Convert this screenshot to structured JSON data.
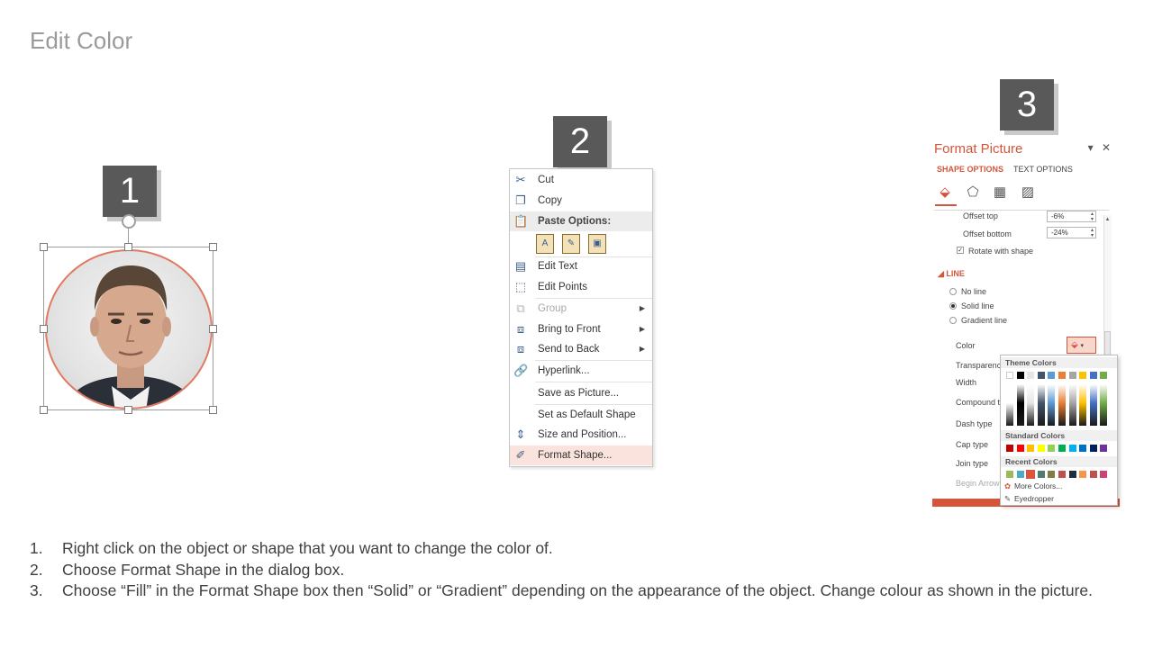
{
  "slide": {
    "title": "Edit Color"
  },
  "badges": [
    "1",
    "2",
    "3"
  ],
  "context_menu": {
    "items": [
      {
        "label": "Cut",
        "icon": "scissors-icon"
      },
      {
        "label": "Copy",
        "icon": "copy-icon"
      },
      {
        "label": "Paste Options:",
        "icon": "paste-icon"
      },
      {
        "label": "Edit Text",
        "icon": "edit-text-icon"
      },
      {
        "label": "Edit Points",
        "icon": "edit-points-icon"
      },
      {
        "label": "Group",
        "icon": "group-icon",
        "disabled": true
      },
      {
        "label": "Bring to Front",
        "icon": "bring-to-front-icon"
      },
      {
        "label": "Send to Back",
        "icon": "send-to-back-icon"
      },
      {
        "label": "Hyperlink...",
        "icon": "hyperlink-icon"
      },
      {
        "label": "Save as Picture..."
      },
      {
        "label": "Set as Default Shape"
      },
      {
        "label": "Size and Position...",
        "icon": "size-position-icon"
      },
      {
        "label": "Format Shape...",
        "icon": "format-shape-icon",
        "highlighted": true
      }
    ],
    "highlight_color": "#fae3dc"
  },
  "format_pane": {
    "title": "Format Picture",
    "tabs": [
      "SHAPE OPTIONS",
      "TEXT OPTIONS"
    ],
    "accent": "#d4553a",
    "offset_top_label": "Offset top",
    "offset_top_value": "-6%",
    "offset_bottom_label": "Offset bottom",
    "offset_bottom_value": "-24%",
    "rotate_label": "Rotate with shape",
    "line_section": "LINE",
    "no_line": "No line",
    "solid_line": "Solid line",
    "gradient_line": "Gradient line",
    "color_label": "Color",
    "transparency_label": "Transparency",
    "width_label": "Width",
    "compound_label": "Compound type",
    "dash_label": "Dash type",
    "cap_label": "Cap type",
    "join_label": "Join type",
    "begin_arrow_label": "Begin Arrow type"
  },
  "color_picker": {
    "theme_header": "Theme Colors",
    "standard_header": "Standard Colors",
    "recent_header": "Recent Colors",
    "more_colors": "More Colors...",
    "eyedropper": "Eyedropper",
    "theme_top": [
      "#ffffff",
      "#000000",
      "#e7e6e6",
      "#44546a",
      "#5b9bd5",
      "#ed7d31",
      "#a5a5a5",
      "#ffc000",
      "#4472c4",
      "#70ad47"
    ],
    "standard": [
      "#c00000",
      "#ff0000",
      "#ffc000",
      "#ffff00",
      "#92d050",
      "#00b050",
      "#00b0f0",
      "#0070c0",
      "#002060",
      "#7030a0"
    ],
    "recent": [
      "#9bbb59",
      "#4bacc6",
      "#e0553a",
      "#4f7d6e",
      "#7f7f3f",
      "#c0504d",
      "#1f2d3d",
      "#f79646",
      "#c0504d",
      "#d04070"
    ]
  },
  "instructions": [
    {
      "num": "1.",
      "text": "Right click on the object or shape that you want to change the color of."
    },
    {
      "num": "2.",
      "text": "Choose Format Shape in the dialog box."
    },
    {
      "num": "3.",
      "text": "Choose “Fill” in the Format Shape box then “Solid” or “Gradient” depending on the appearance of the object. Change colour as shown in the picture."
    }
  ]
}
